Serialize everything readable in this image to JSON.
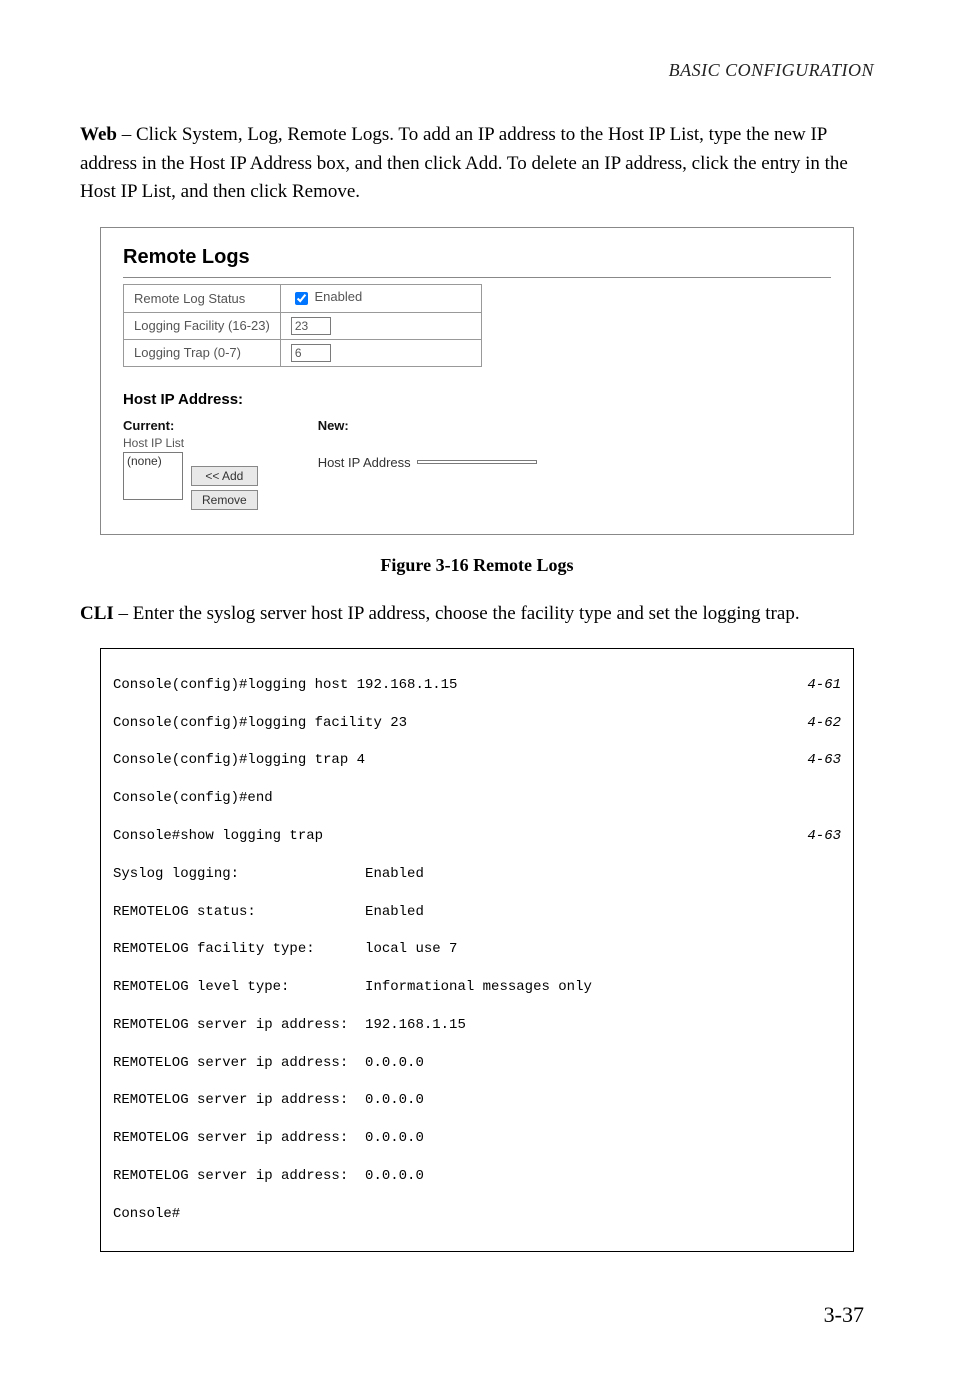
{
  "header": "BASIC CONFIGURATION",
  "intro": {
    "bold": "Web",
    "rest": " – Click System, Log, Remote Logs. To add an IP address to the Host IP List, type the new IP address in the Host IP Address box, and then click Add. To delete an IP address, click the entry in the Host IP List, and then click Remove."
  },
  "screenshot": {
    "title": "Remote Logs",
    "rows": [
      {
        "label": "Remote Log Status",
        "enabled_label": "Enabled",
        "checked": true
      },
      {
        "label": "Logging Facility (16-23)",
        "value": "23"
      },
      {
        "label": "Logging Trap (0-7)",
        "value": "6"
      }
    ],
    "host_title": "Host IP Address:",
    "current_label": "Current:",
    "new_label": "New:",
    "host_ip_list_label": "Host IP List",
    "list_item": "(none)",
    "btn_add": "<< Add",
    "btn_remove": "Remove",
    "new_field_label": "Host IP Address",
    "new_field_value": ""
  },
  "figure_caption": "Figure 3-16  Remote Logs",
  "cli_intro": {
    "bold": "CLI",
    "rest": " – Enter the syslog server host IP address, choose the facility type and set the logging trap."
  },
  "cli": {
    "lines": [
      {
        "text": "Console(config)#logging host 192.168.1.15",
        "ref": "4-61"
      },
      {
        "text": "Console(config)#logging facility 23",
        "ref": "4-62"
      },
      {
        "text": "Console(config)#logging trap 4",
        "ref": "4-63"
      },
      {
        "text": "Console(config)#end",
        "ref": ""
      },
      {
        "text": "Console#show logging trap",
        "ref": "4-63"
      },
      {
        "text": "Syslog logging:               Enabled",
        "ref": ""
      },
      {
        "text": "REMOTELOG status:             Enabled",
        "ref": ""
      },
      {
        "text": "REMOTELOG facility type:      local use 7",
        "ref": ""
      },
      {
        "text": "REMOTELOG level type:         Informational messages only",
        "ref": ""
      },
      {
        "text": "REMOTELOG server ip address:  192.168.1.15",
        "ref": ""
      },
      {
        "text": "REMOTELOG server ip address:  0.0.0.0",
        "ref": ""
      },
      {
        "text": "REMOTELOG server ip address:  0.0.0.0",
        "ref": ""
      },
      {
        "text": "REMOTELOG server ip address:  0.0.0.0",
        "ref": ""
      },
      {
        "text": "REMOTELOG server ip address:  0.0.0.0",
        "ref": ""
      },
      {
        "text": "Console#",
        "ref": ""
      }
    ]
  },
  "page_number": "3-37"
}
